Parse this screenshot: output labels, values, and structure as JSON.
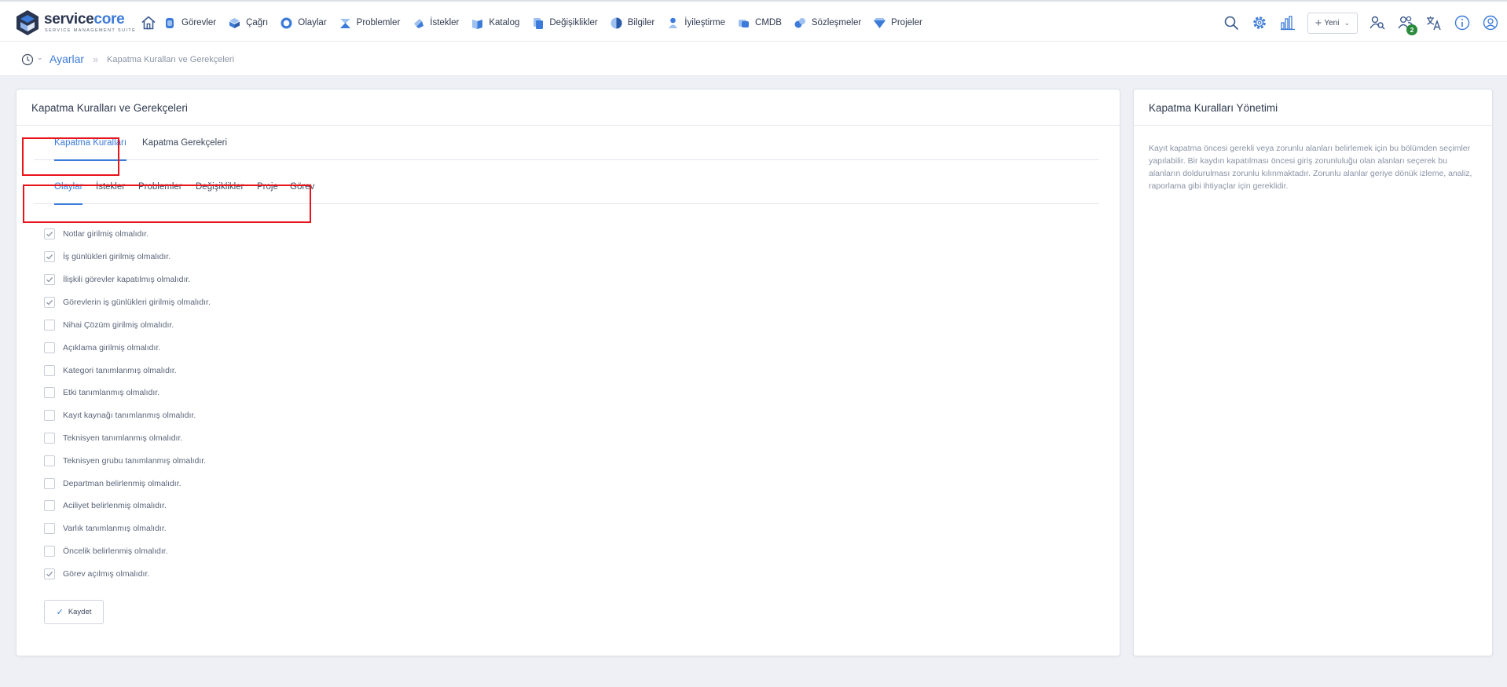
{
  "logo": {
    "name_a": "service",
    "name_b": "core",
    "tagline": "SERVICE MANAGEMENT SUITE"
  },
  "nav": {
    "items": [
      {
        "label": "Görevler",
        "icon": "tasks-icon"
      },
      {
        "label": "Çağrı",
        "icon": "call-icon"
      },
      {
        "label": "Olaylar",
        "icon": "incidents-icon"
      },
      {
        "label": "Problemler",
        "icon": "problems-icon"
      },
      {
        "label": "İstekler",
        "icon": "requests-icon"
      },
      {
        "label": "Katalog",
        "icon": "catalog-icon"
      },
      {
        "label": "Değişiklikler",
        "icon": "changes-icon"
      },
      {
        "label": "Bilgiler",
        "icon": "knowledge-icon"
      },
      {
        "label": "İyileştirme",
        "icon": "improvement-icon"
      },
      {
        "label": "CMDB",
        "icon": "cmdb-icon"
      },
      {
        "label": "Sözleşmeler",
        "icon": "contracts-icon"
      },
      {
        "label": "Projeler",
        "icon": "projects-icon"
      }
    ]
  },
  "toolbar": {
    "new_label": "Yeni",
    "notification_count": "2"
  },
  "breadcrumb": {
    "root": "Ayarlar",
    "current": "Kapatma Kuralları ve Gerekçeleri"
  },
  "main": {
    "title": "Kapatma Kuralları ve Gerekçeleri",
    "tabs": [
      {
        "label": "Kapatma Kuralları",
        "active": true
      },
      {
        "label": "Kapatma Gerekçeleri",
        "active": false
      }
    ],
    "subtabs": [
      {
        "label": "Olaylar",
        "active": true
      },
      {
        "label": "İstekler",
        "active": false
      },
      {
        "label": "Problemler",
        "active": false
      },
      {
        "label": "Değişiklikler",
        "active": false
      },
      {
        "label": "Proje",
        "active": false
      },
      {
        "label": "Görev",
        "active": false
      }
    ],
    "rules": [
      {
        "label": "Notlar girilmiş olmalıdır.",
        "checked": true
      },
      {
        "label": "İş günlükleri girilmiş olmalıdır.",
        "checked": true
      },
      {
        "label": "İlişkili görevler kapatılmış olmalıdır.",
        "checked": true
      },
      {
        "label": "Görevlerin iş günlükleri girilmiş olmalıdır.",
        "checked": true
      },
      {
        "label": "Nihai Çözüm girilmiş olmalıdır.",
        "checked": false
      },
      {
        "label": "Açıklama girilmiş olmalıdır.",
        "checked": false
      },
      {
        "label": "Kategori tanımlanmış olmalıdır.",
        "checked": false
      },
      {
        "label": "Etki tanımlanmış olmalıdır.",
        "checked": false
      },
      {
        "label": "Kayıt kaynağı tanımlanmış olmalıdır.",
        "checked": false
      },
      {
        "label": "Teknisyen tanımlanmış olmalıdır.",
        "checked": false
      },
      {
        "label": "Teknisyen grubu tanımlanmış olmalıdır.",
        "checked": false
      },
      {
        "label": "Departman belirlenmiş olmalıdır.",
        "checked": false
      },
      {
        "label": "Aciliyet belirlenmiş olmalıdır.",
        "checked": false
      },
      {
        "label": "Varlık tanımlanmış olmalıdır.",
        "checked": false
      },
      {
        "label": "Öncelik belirlenmiş olmalıdır.",
        "checked": false
      },
      {
        "label": "Görev açılmış olmalıdır.",
        "checked": true
      }
    ],
    "save_label": "Kaydet"
  },
  "side": {
    "title": "Kapatma Kuralları Yönetimi",
    "description": "Kayıt kapatma öncesi gerekli veya zorunlu alanları belirlemek için bu bölümden seçimler yapılabilir. Bir kaydın kapatılması öncesi giriş zorunluluğu olan alanları seçerek bu alanların doldurulması zorunlu kılınmaktadır. Zorunlu alanlar geriye dönük izleme, analiz, raporlama gibi ihtiyaçlar için gereklidir."
  },
  "colors": {
    "accent": "#3c7bd9",
    "highlight": "#e8141b",
    "badge": "#2a8a3c"
  }
}
